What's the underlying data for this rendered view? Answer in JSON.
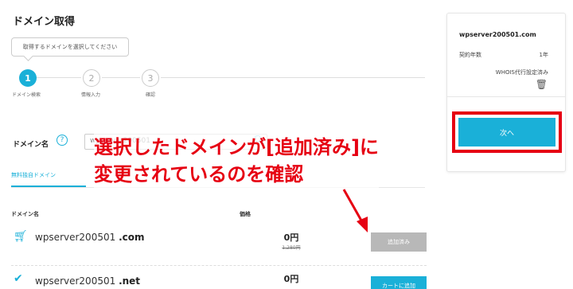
{
  "page": {
    "title": "ドメイン取得"
  },
  "tooltip": {
    "text": "取得するドメインを選択してください"
  },
  "steps": [
    {
      "number": "1",
      "label": "ドメイン検索"
    },
    {
      "number": "2",
      "label": "情報入力"
    },
    {
      "number": "3",
      "label": "確認"
    }
  ],
  "search": {
    "label": "ドメイン名",
    "help": "?",
    "value": "wpserver200501"
  },
  "tabs": {
    "free": "無料独自ドメイン"
  },
  "table": {
    "headers": {
      "domain": "ドメイン名",
      "price": "価格"
    },
    "rows": [
      {
        "name": "wpserver200501",
        "tld": ".com",
        "price": "0円",
        "old_price": "1,280円",
        "button": "追加済み"
      },
      {
        "name": "wpserver200501",
        "tld": ".net",
        "price": "0円",
        "button": "カートに追加"
      }
    ]
  },
  "sidebar": {
    "domain": "wpserver200501.com",
    "term_label": "契約年数",
    "term_value": "1年",
    "whois": "WHOIS代行設定済み",
    "next_button": "次へ"
  },
  "annotation": {
    "line1": "選択したドメインが[追加済み]に",
    "line2": "変更されているのを確認"
  },
  "colors": {
    "accent": "#1ab0d8",
    "annotation": "#e60012",
    "added_button": "#b8b8b8"
  }
}
